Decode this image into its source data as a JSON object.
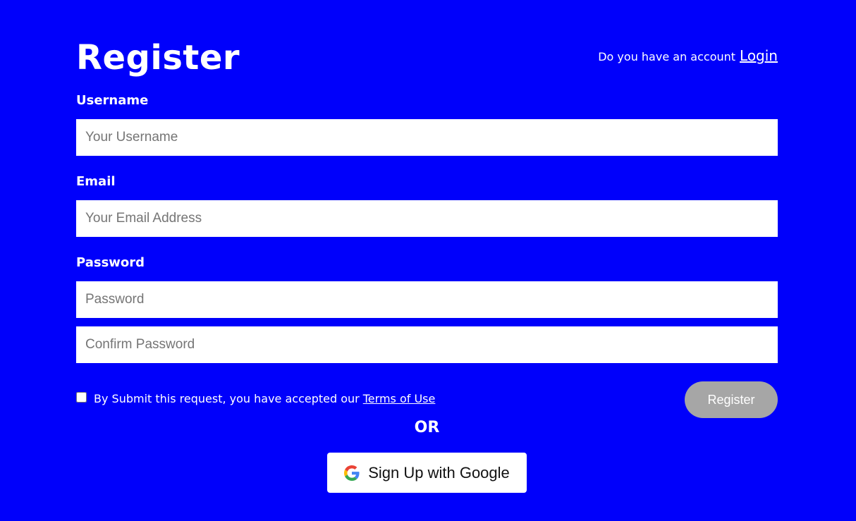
{
  "page": {
    "background": "#0000fb"
  },
  "header": {
    "title": "Register",
    "account_prompt": "Do you have an account",
    "login_label": "Login"
  },
  "form": {
    "username": {
      "label": "Username",
      "placeholder": "Your Username",
      "value": ""
    },
    "email": {
      "label": "Email",
      "placeholder": "Your Email Address",
      "value": ""
    },
    "password": {
      "label": "Password",
      "placeholder": "Password",
      "value": ""
    },
    "confirm_password": {
      "placeholder": "Confirm Password",
      "value": ""
    },
    "terms": {
      "checked": false,
      "text": "By Submit this request, you have accepted our",
      "link_label": "Terms of Use"
    },
    "register_label": "Register",
    "register_color": "#a6a6a6"
  },
  "divider": {
    "label": "OR"
  },
  "google": {
    "label": "Sign Up with Google",
    "icon": "google-icon"
  }
}
